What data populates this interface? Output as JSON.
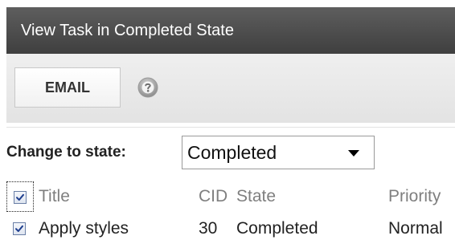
{
  "window": {
    "title": "View Task in Completed State"
  },
  "toolbar": {
    "email_label": "EMAIL",
    "help_icon": "help-icon"
  },
  "state_change": {
    "label": "Change to state:",
    "selected": "Completed"
  },
  "grid": {
    "columns": [
      "Title",
      "CID",
      "State",
      "Priority"
    ],
    "header_checked": true,
    "rows": [
      {
        "checked": true,
        "title": "Apply styles",
        "cid": "30",
        "state": "Completed",
        "priority": "Normal"
      }
    ]
  },
  "colors": {
    "titlebar": "#4a4a4a",
    "toolbar": "#e8e8e8",
    "header_text": "#7f7f7f"
  }
}
